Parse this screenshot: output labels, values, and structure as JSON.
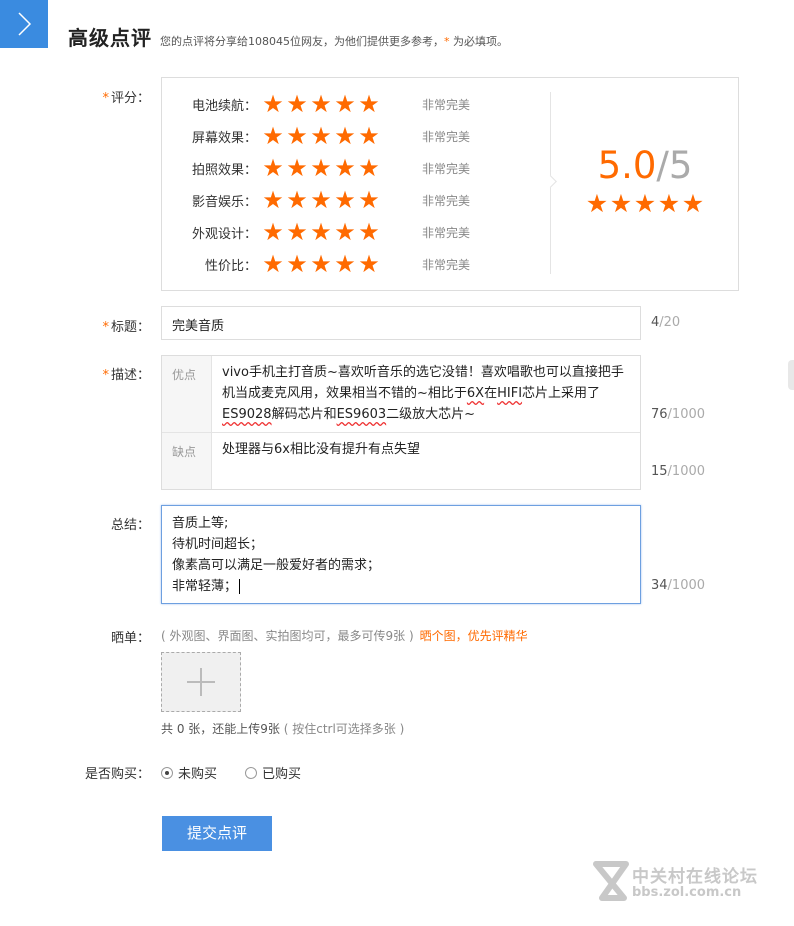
{
  "header": {
    "title": "高级点评",
    "subtitle_prefix": "您的点评将分享给108045位网友，为他们提供更多参考，",
    "required_mark": "*",
    "subtitle_suffix": " 为必填项。"
  },
  "labels": {
    "rating": "评分：",
    "title": "标题：",
    "description": "描述：",
    "summary": "总结：",
    "photos": "晒单：",
    "purchased": "是否购买：",
    "required_mark": "*"
  },
  "ratings": [
    {
      "name": "电池续航：",
      "stars": 5,
      "desc": "非常完美"
    },
    {
      "name": "屏幕效果：",
      "stars": 5,
      "desc": "非常完美"
    },
    {
      "name": "拍照效果：",
      "stars": 5,
      "desc": "非常完美"
    },
    {
      "name": "影音娱乐：",
      "stars": 5,
      "desc": "非常完美"
    },
    {
      "name": "外观设计：",
      "stars": 5,
      "desc": "非常完美"
    },
    {
      "name": "性价比：",
      "stars": 5,
      "desc": "非常完美"
    }
  ],
  "overall": {
    "score": "5.0",
    "separator": "/",
    "max": "5",
    "stars": 5
  },
  "title_field": {
    "value": "完美音质",
    "count": "4",
    "max": "/20"
  },
  "description": {
    "pros_tag": "优点",
    "pros_parts": [
      "vivo手机主打音质~喜欢听音乐的选它没错！喜欢唱歌也可以直接把手机当成麦克风用，效果相当不错的~相比于",
      "6X",
      "在",
      "HIFI",
      "芯片上采用了",
      "ES9028",
      "解码芯片和",
      "ES9603",
      "二级放大芯片~"
    ],
    "pros_count": "76",
    "pros_max": "/1000",
    "cons_tag": "缺点",
    "cons_text": "处理器与6x相比没有提升有点失望",
    "cons_count": "15",
    "cons_max": "/1000"
  },
  "summary": {
    "lines": [
      "音质上等;",
      "待机时间超长；",
      "像素高可以满足一般爱好者的需求；",
      "非常轻薄；"
    ],
    "count": "34",
    "max": "/1000"
  },
  "photos": {
    "hint": "( 外观图、界面图、实拍图均可，最多可传9张 )",
    "highlight": "晒个图，优先评精华",
    "count_text": "共 0 张，还能上传9张",
    "count_hint": "( 按住ctrl可选择多张 )"
  },
  "purchase": {
    "options": [
      {
        "label": "未购买",
        "checked": true
      },
      {
        "label": "已购买",
        "checked": false
      }
    ]
  },
  "submit_label": "提交点评",
  "watermark": {
    "main": "中关村在线论坛",
    "sub": "bbs.zol.com.cn"
  },
  "colors": {
    "accent": "#ff6a00",
    "primary": "#4a90e2",
    "toggle": "#3a8be0"
  }
}
